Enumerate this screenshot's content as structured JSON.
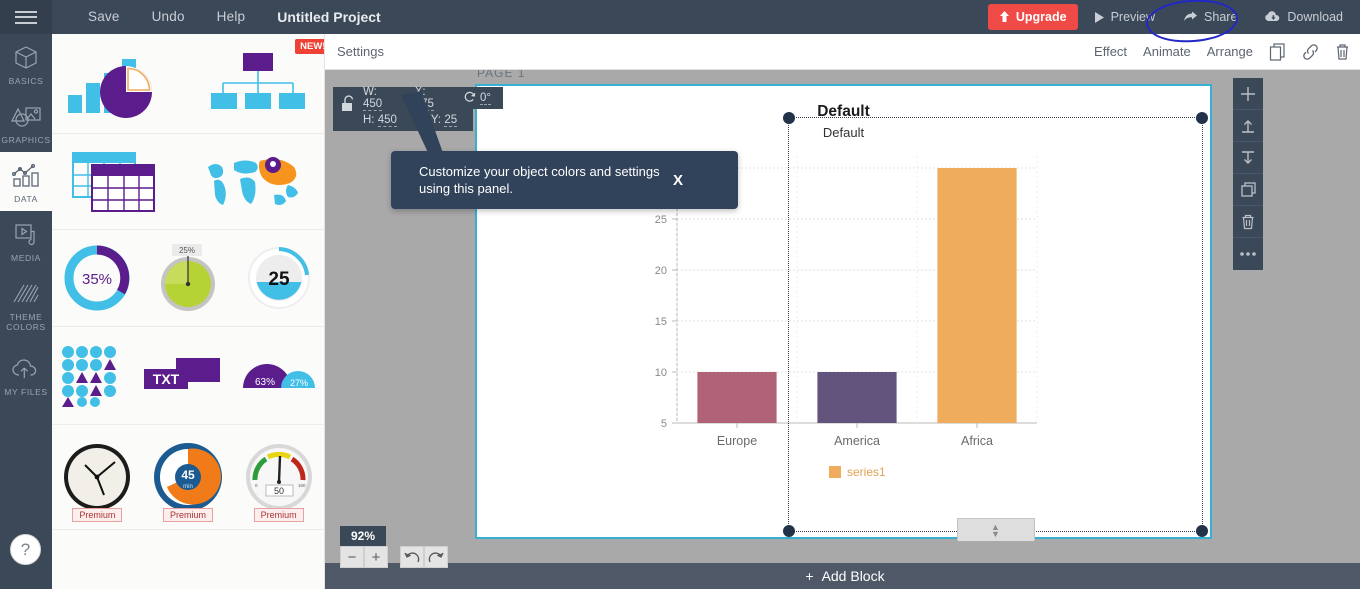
{
  "topbar": {
    "menu": [
      {
        "label": "Save",
        "name": "save"
      },
      {
        "label": "Undo",
        "name": "undo"
      },
      {
        "label": "Help",
        "name": "help"
      }
    ],
    "project_title": "Untitled Project",
    "upgrade_label": "Upgrade",
    "preview_label": "Preview",
    "share_label": "Share",
    "download_label": "Download",
    "upgrade_color": "#f04a46",
    "bar_color": "#3b4858"
  },
  "rail": {
    "items": [
      {
        "label": "BASICS",
        "icon": "cube-icon",
        "active": false
      },
      {
        "label": "GRAPHICS",
        "icon": "image-shapes-icon",
        "active": false
      },
      {
        "label": "DATA",
        "icon": "chart-data-icon",
        "active": true
      },
      {
        "label": "MEDIA",
        "icon": "video-play-icon",
        "active": false
      },
      {
        "label": "THEME\nCOLORS",
        "icon": "diagonal-lines-icon",
        "active": false
      },
      {
        "label": "MY FILES",
        "icon": "cloud-upload-icon",
        "active": false
      }
    ]
  },
  "assets": {
    "badge_new": "NEW!",
    "premium_label": "Premium",
    "items": [
      {
        "name": "charts-thumb",
        "caption": ""
      },
      {
        "name": "org-chart-thumb",
        "caption": ""
      },
      {
        "name": "table-thumb",
        "caption": ""
      },
      {
        "name": "map-thumb",
        "caption": ""
      },
      {
        "name": "donut-35-thumb",
        "value": "35%"
      },
      {
        "name": "pie-gauge-25-thumb",
        "value": "25%"
      },
      {
        "name": "level-gauge-25-thumb",
        "value": "25"
      },
      {
        "name": "dot-matrix-thumb",
        "caption": ""
      },
      {
        "name": "txt-badge-thumb",
        "value": "TXT"
      },
      {
        "name": "semicircle-thumb",
        "value_a": "63%",
        "value_b": "27%"
      },
      {
        "name": "clock-thumb",
        "caption": ""
      },
      {
        "name": "timer-45-thumb",
        "value": "45",
        "unit": "min"
      },
      {
        "name": "speedometer-50-thumb",
        "value": "50",
        "min": "0",
        "max": "100"
      }
    ]
  },
  "settingsbar": {
    "label": "Settings",
    "effect": "Effect",
    "animate": "Animate",
    "arrange": "Arrange",
    "icons": [
      "duplicate-icon",
      "link-icon",
      "trash-icon"
    ]
  },
  "canvas": {
    "page_tag": "PAGE 1",
    "props": {
      "width_label": "W:",
      "width_value": "450",
      "x_label": "X:",
      "x_value": "175",
      "rotation_label": "0°",
      "height_label": "H:",
      "height_value": "450",
      "y_label": "Y:",
      "y_value": "25"
    }
  },
  "tooltip": {
    "text": "Customize your object colors and settings using this panel.",
    "close_label": "X"
  },
  "vtools": {
    "items": [
      {
        "name": "add-icon"
      },
      {
        "name": "align-top-icon"
      },
      {
        "name": "align-bottom-icon"
      },
      {
        "name": "duplicate-layers-icon"
      },
      {
        "name": "delete-trash-icon"
      },
      {
        "name": "more-options-icon"
      }
    ]
  },
  "zoom_controls": {
    "level": "92%",
    "minus": "−",
    "plus": "+",
    "undo_icon": "rotate-left-icon",
    "redo_icon": "rotate-right-icon"
  },
  "add_block": {
    "label": "Add Block",
    "plus": "+"
  },
  "help": {
    "label": "?"
  },
  "chart_data": {
    "type": "bar",
    "title": "Default",
    "subtitle": "Default",
    "categories": [
      "Europe",
      "America",
      "Africa"
    ],
    "values": [
      10,
      10,
      30
    ],
    "series": [
      {
        "name": "series1",
        "values": [
          10,
          10,
          30
        ]
      }
    ],
    "bar_colors": [
      "#b06377",
      "#63547e",
      "#f0ac5d"
    ],
    "legend": [
      "series1"
    ],
    "legend_position": "bottom",
    "legend_color": "#f0ac5d",
    "ylabel": "",
    "xlabel": "",
    "yticks": [
      5,
      10,
      15,
      20,
      25,
      30
    ],
    "ylim": [
      5,
      30
    ],
    "grid": true,
    "tick_color": "#8a8a8a"
  }
}
